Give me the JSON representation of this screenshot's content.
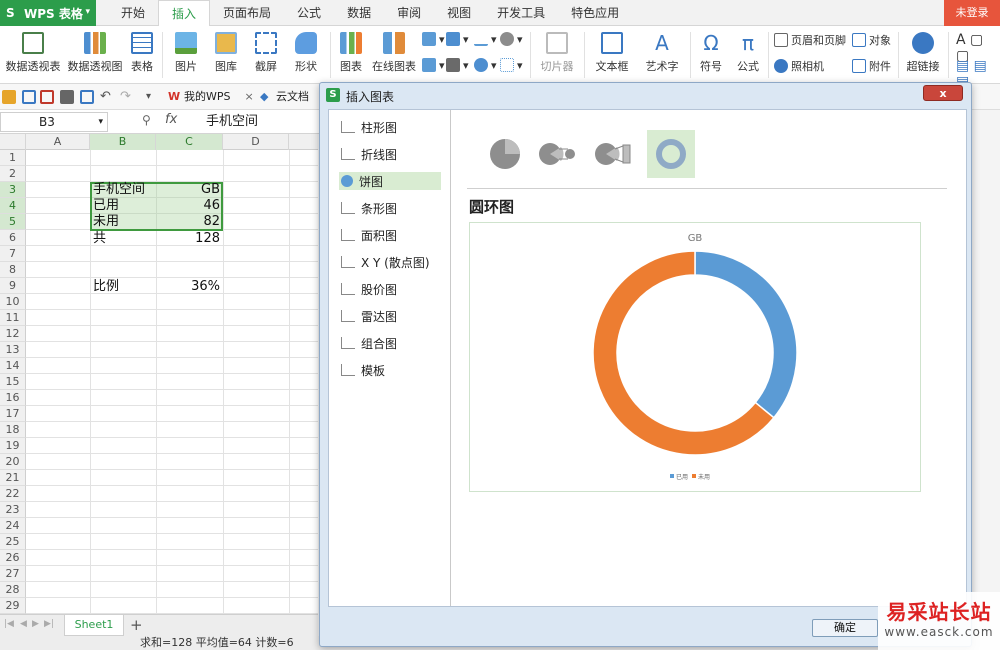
{
  "app": {
    "title": "WPS 表格",
    "login": "未登录"
  },
  "tabs": [
    {
      "label": "开始"
    },
    {
      "label": "插入",
      "active": true
    },
    {
      "label": "页面布局"
    },
    {
      "label": "公式"
    },
    {
      "label": "数据"
    },
    {
      "label": "审阅"
    },
    {
      "label": "视图"
    },
    {
      "label": "开发工具"
    },
    {
      "label": "特色应用"
    }
  ],
  "ribbon": {
    "pivot_table": "数据透视表",
    "pivot_chart": "数据透视图",
    "table": "表格",
    "picture": "图片",
    "gallery": "图库",
    "screenshot": "截屏",
    "shape": "形状",
    "chart": "图表",
    "online_chart": "在线图表",
    "slicer": "切片器",
    "textbox": "文本框",
    "wordart": "艺术字",
    "symbol": "符号",
    "formula": "公式",
    "header_footer": "页眉和页脚",
    "object": "对象",
    "camera": "照相机",
    "attachment": "附件",
    "hyperlink": "超链接"
  },
  "quickbar": {
    "my_wps": "我的WPS",
    "cloud_doc": "云文档"
  },
  "formula_bar": {
    "name_box": "B3",
    "fx": "fx",
    "content": "手机空间"
  },
  "grid": {
    "columns": [
      "A",
      "B",
      "C",
      "D"
    ],
    "rows": [
      "1",
      "2",
      "3",
      "4",
      "5",
      "6",
      "7",
      "8",
      "9",
      "10",
      "11",
      "12",
      "13",
      "14",
      "15",
      "16",
      "17",
      "18",
      "19",
      "20",
      "21",
      "22",
      "23",
      "24",
      "25",
      "26",
      "27",
      "28",
      "29"
    ],
    "cells": {
      "B3": "手机空间",
      "C3": "GB",
      "B4": "已用",
      "C4": "46",
      "B5": "未用",
      "C5": "82",
      "B6": "共",
      "C6": "128",
      "B9": "比例",
      "C9": "36%"
    }
  },
  "sheet": {
    "tab": "Sheet1",
    "add": "+"
  },
  "status": {
    "text": "求和=128  平均值=64  计数=6"
  },
  "dialog": {
    "title": "插入图表",
    "close": "x",
    "categories": [
      {
        "label": "柱形图"
      },
      {
        "label": "折线图"
      },
      {
        "label": "饼图",
        "active": true
      },
      {
        "label": "条形图"
      },
      {
        "label": "面积图"
      },
      {
        "label": "X Y (散点图)"
      },
      {
        "label": "股价图"
      },
      {
        "label": "雷达图"
      },
      {
        "label": "组合图"
      },
      {
        "label": "模板"
      }
    ],
    "subtype_title": "圆环图",
    "ok": "确定"
  },
  "colors": {
    "used": "#5b9bd5",
    "unused": "#ed7d31",
    "accent": "#2c9d4b"
  },
  "chart_data": {
    "type": "pie",
    "subtype": "doughnut",
    "title": "GB",
    "categories": [
      "已用",
      "未用"
    ],
    "values": [
      46,
      82
    ],
    "colors": [
      "#5b9bd5",
      "#ed7d31"
    ],
    "legend": "bottom"
  },
  "watermark": {
    "line1": "易采站长站",
    "line2": "www.easck.com"
  }
}
